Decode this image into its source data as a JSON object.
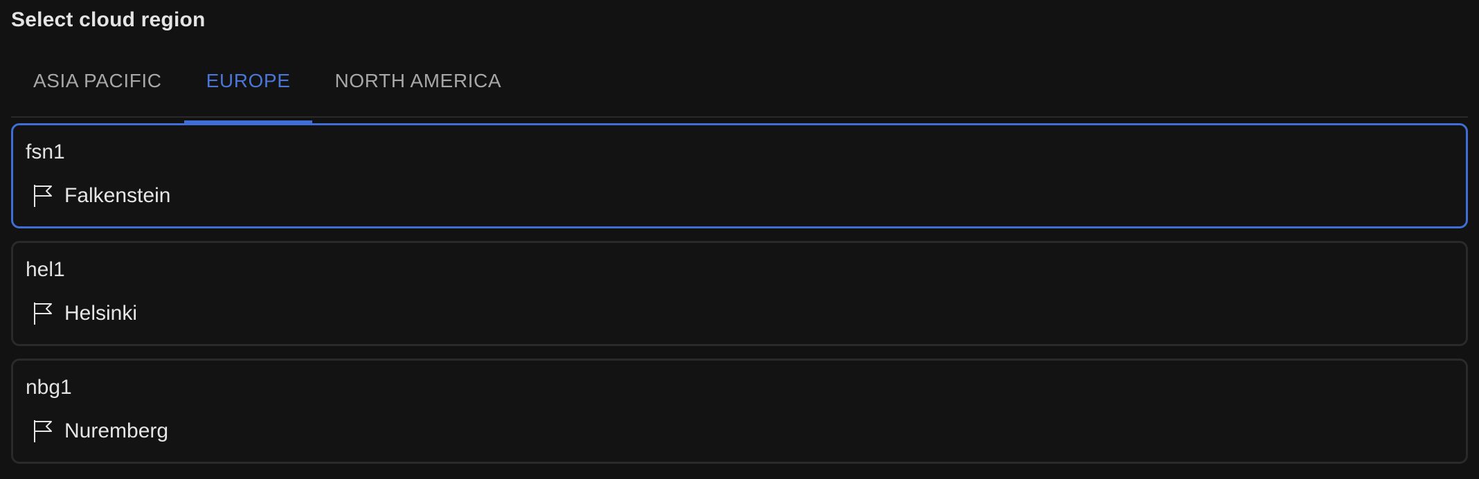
{
  "title": "Select cloud region",
  "tabs": [
    {
      "label": "ASIA PACIFIC",
      "active": false
    },
    {
      "label": "EUROPE",
      "active": true
    },
    {
      "label": "NORTH AMERICA",
      "active": false
    }
  ],
  "regions": [
    {
      "code": "fsn1",
      "city": "Falkenstein",
      "icon": "flag-icon",
      "selected": true
    },
    {
      "code": "hel1",
      "city": "Helsinki",
      "icon": "flag-icon",
      "selected": false
    },
    {
      "code": "nbg1",
      "city": "Nuremberg",
      "icon": "flag-icon",
      "selected": false
    }
  ],
  "colors": {
    "background": "#121212",
    "accent": "#3f6fd6",
    "border": "#2a2a2a",
    "text": "#e6e6e6",
    "tab_inactive": "#a7a7a7"
  }
}
